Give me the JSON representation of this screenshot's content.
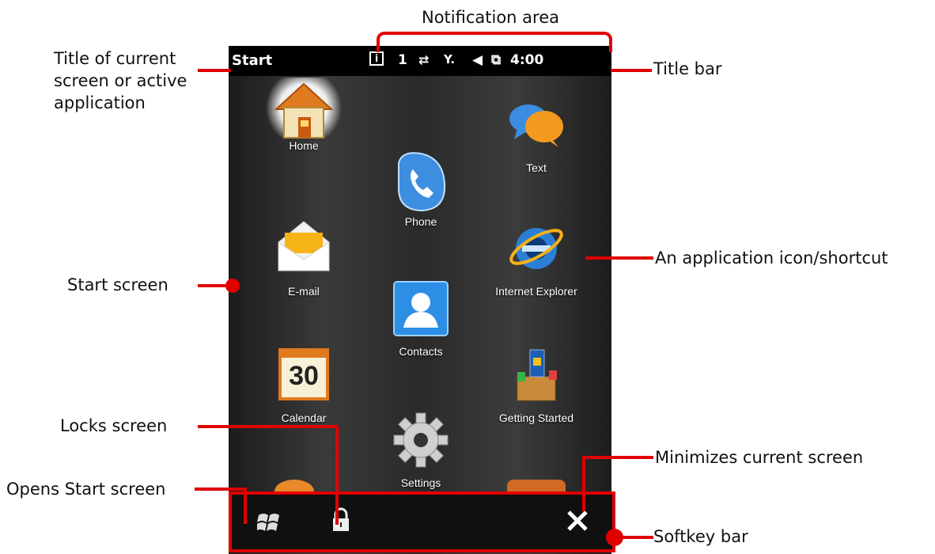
{
  "callouts": {
    "notification_area": "Notification area",
    "title_current": "Title of current\nscreen or active\napplication",
    "title_bar": "Title bar",
    "app_icon": "An application icon/shortcut",
    "start_screen": "Start screen",
    "locks_screen": "Locks screen",
    "minimizes": "Minimizes current screen",
    "opens_start": "Opens Start screen",
    "softkey_bar": "Softkey bar"
  },
  "titlebar": {
    "title": "Start",
    "notif_count": "1",
    "time": "4:00"
  },
  "apps": {
    "home": "Home",
    "text": "Text",
    "phone": "Phone",
    "email": "E-mail",
    "ie": "Internet Explorer",
    "contacts": "Contacts",
    "calendar": "Calendar",
    "calendar_day": "30",
    "getting_started": "Getting Started",
    "settings": "Settings"
  },
  "colors": {
    "annotation": "#e00000",
    "titlebar_bg": "#000000",
    "softkey_bg": "#101010"
  }
}
